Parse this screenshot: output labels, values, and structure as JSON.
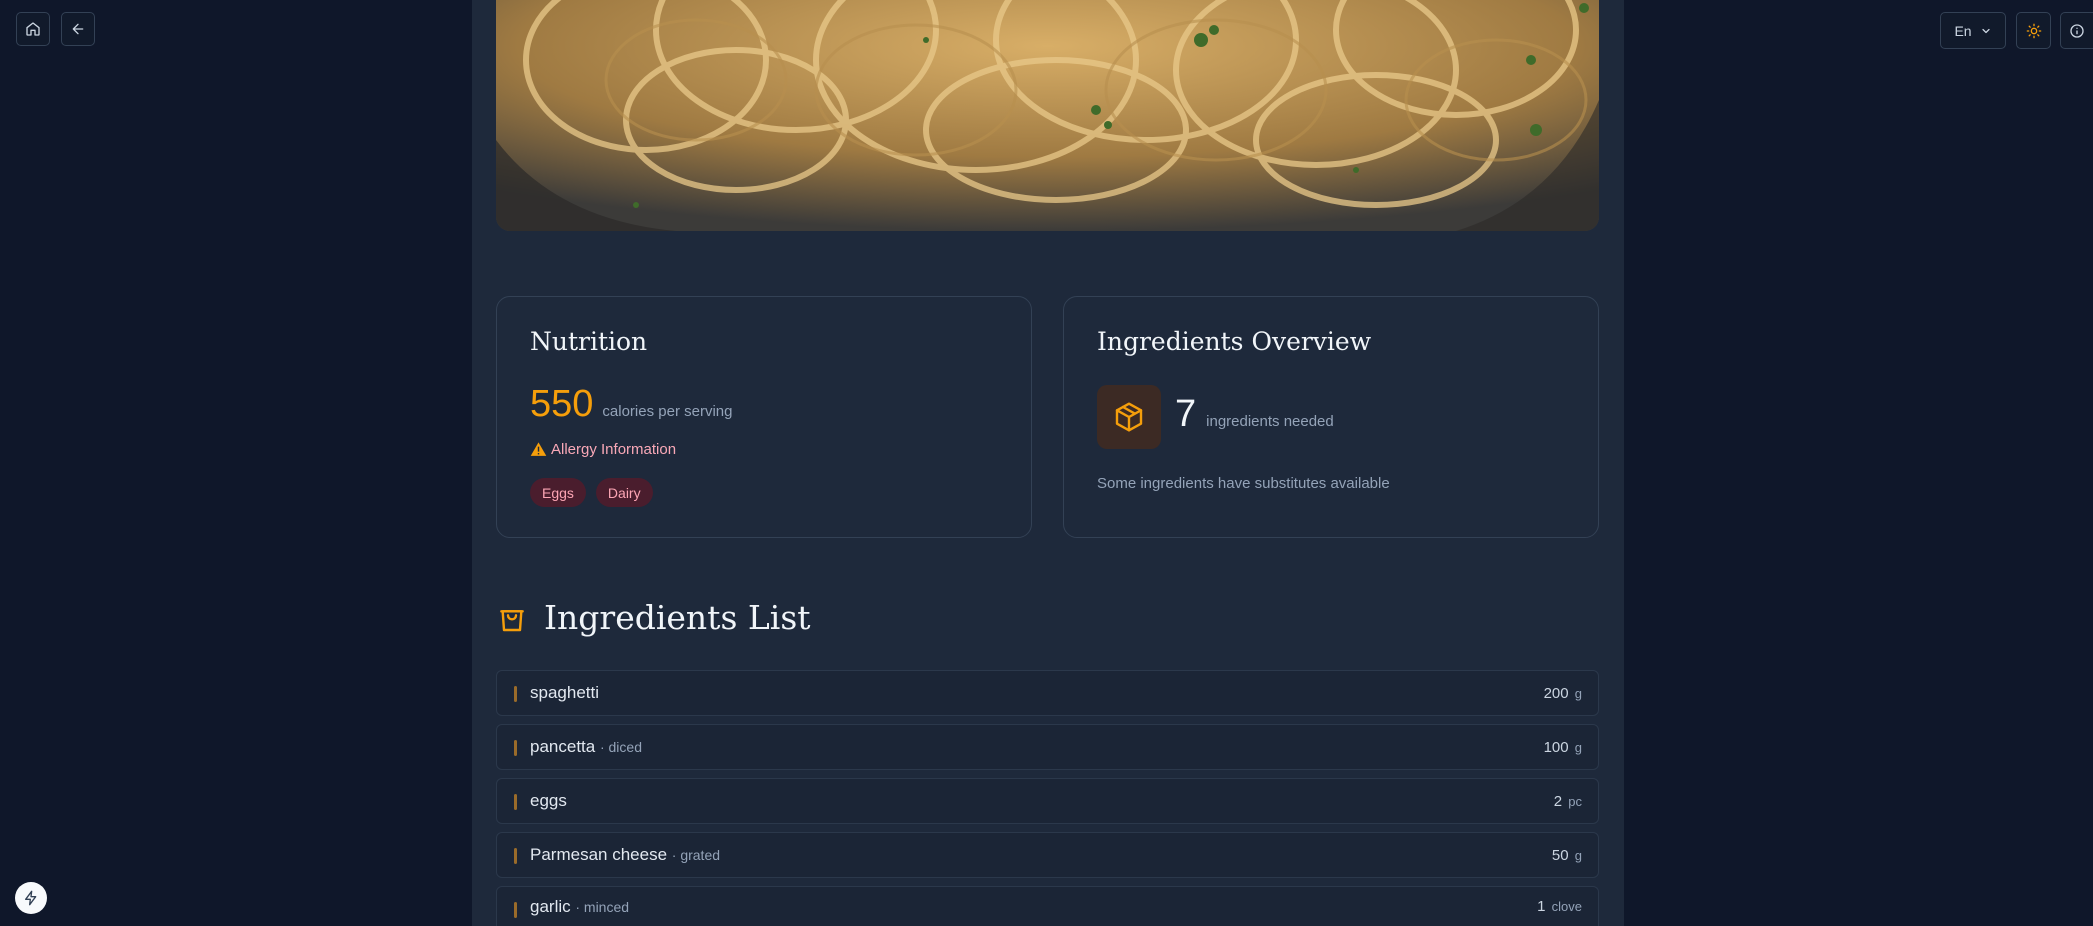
{
  "nav": {
    "home_icon": "home-icon",
    "back_icon": "arrow-left-icon"
  },
  "controls": {
    "language": "En",
    "theme_icon": "sun-icon",
    "info_icon": "info-icon"
  },
  "hero": {
    "image": "spaghetti-carbonara-photo"
  },
  "nutrition": {
    "title": "Nutrition",
    "calories": "550",
    "calories_label": "calories per serving",
    "allergy_title": "Allergy Information",
    "allergens": [
      "Eggs",
      "Dairy"
    ]
  },
  "overview": {
    "title": "Ingredients Overview",
    "count": "7",
    "count_label": "ingredients needed",
    "note": "Some ingredients have substitutes available"
  },
  "ingredients": {
    "title": "Ingredients List",
    "items": [
      {
        "name": "spaghetti",
        "prep": "",
        "amount": "200",
        "unit": "g"
      },
      {
        "name": "pancetta",
        "prep": "· diced",
        "amount": "100",
        "unit": "g"
      },
      {
        "name": "eggs",
        "prep": "",
        "amount": "2",
        "unit": "pc"
      },
      {
        "name": "Parmesan cheese",
        "prep": "· grated",
        "amount": "50",
        "unit": "g"
      },
      {
        "name": "garlic",
        "prep": "· minced",
        "amount": "1",
        "unit": "clove"
      }
    ]
  },
  "colors": {
    "accent": "#f59e0b",
    "background": "#0f172a",
    "panel": "#1e293b",
    "allergy": "#f9a8b7"
  }
}
